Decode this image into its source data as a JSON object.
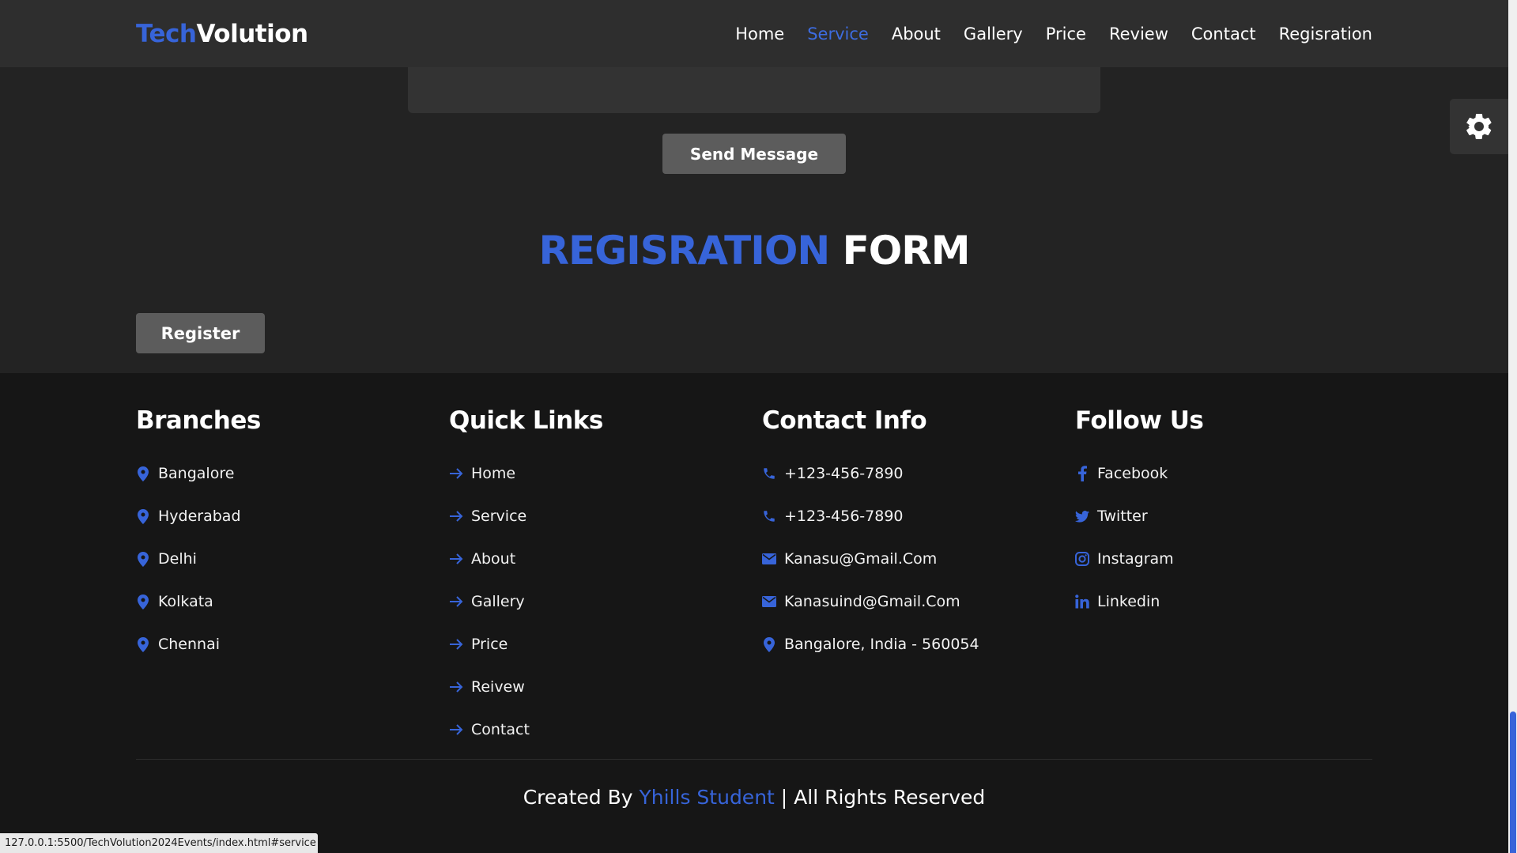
{
  "header": {
    "logo_part1": "Tech",
    "logo_part2": "Volution",
    "nav": [
      {
        "label": "Home",
        "active": false
      },
      {
        "label": "Service",
        "active": true
      },
      {
        "label": "About",
        "active": false
      },
      {
        "label": "Gallery",
        "active": false
      },
      {
        "label": "Price",
        "active": false
      },
      {
        "label": "Review",
        "active": false
      },
      {
        "label": "Contact",
        "active": false
      },
      {
        "label": "Regisration",
        "active": false
      }
    ]
  },
  "contact_form": {
    "send_label": "Send Message"
  },
  "settings": {
    "icon": "gear-icon"
  },
  "registration": {
    "title_accent": "REGISRATION",
    "title_rest": "FORM",
    "register_label": "Register"
  },
  "footer": {
    "branches": {
      "title": "Branches",
      "items": [
        "Bangalore",
        "Hyderabad",
        "Delhi",
        "Kolkata",
        "Chennai"
      ]
    },
    "quick_links": {
      "title": "Quick Links",
      "items": [
        "Home",
        "Service",
        "About",
        "Gallery",
        "Price",
        "Reivew",
        "Contact"
      ]
    },
    "contact_info": {
      "title": "Contact Info",
      "items": [
        {
          "icon": "phone-icon",
          "text": "+123-456-7890"
        },
        {
          "icon": "phone-icon",
          "text": "+123-456-7890"
        },
        {
          "icon": "envelope-icon",
          "text": "Kanasu@Gmail.Com"
        },
        {
          "icon": "envelope-icon",
          "text": "Kanasuind@Gmail.Com"
        },
        {
          "icon": "map-pin-icon",
          "text": "Bangalore, India - 560054"
        }
      ]
    },
    "follow_us": {
      "title": "Follow Us",
      "items": [
        {
          "icon": "facebook-icon",
          "text": "Facebook"
        },
        {
          "icon": "twitter-icon",
          "text": "Twitter"
        },
        {
          "icon": "instagram-icon",
          "text": "Instagram"
        },
        {
          "icon": "linkedin-icon",
          "text": "Linkedin"
        }
      ]
    },
    "credit_prefix": "Created By",
    "credit_name": "Yhills Student",
    "credit_suffix": "| All Rights Reserved"
  },
  "status_bar": {
    "url": "127.0.0.1:5500/TechVolution2024Events/index.html#service"
  },
  "colors": {
    "accent": "#3764d9",
    "background": "#232323",
    "footer_background": "#161616",
    "header_background": "#2e2e2e",
    "button": "#5c5c5c"
  }
}
